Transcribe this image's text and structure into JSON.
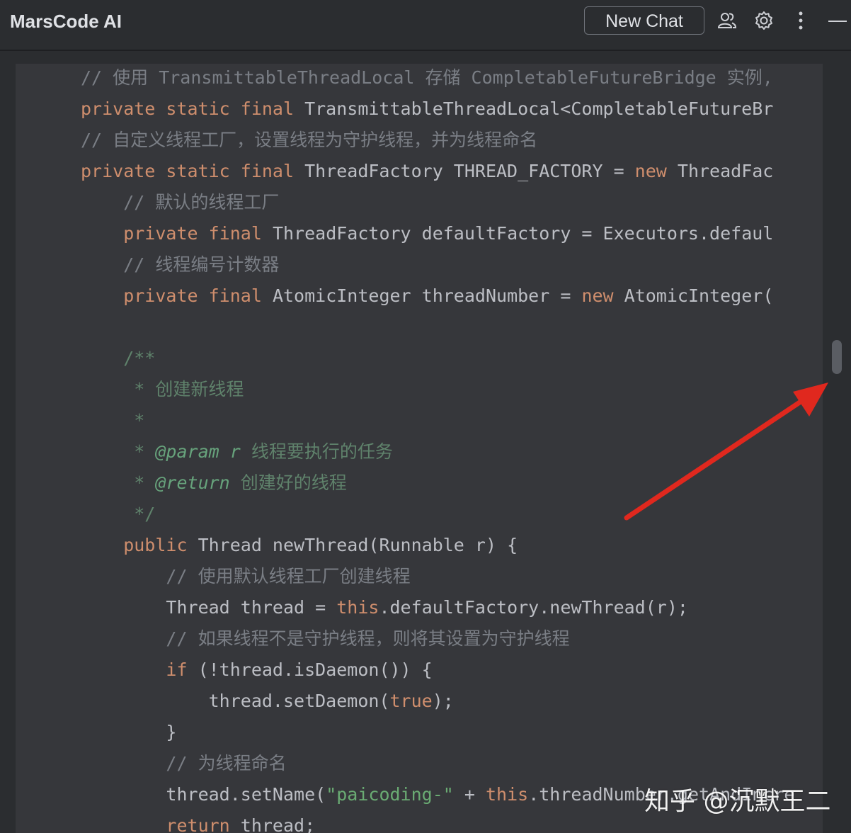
{
  "header": {
    "title": "MarsCode AI",
    "new_chat_label": "New Chat",
    "icons": [
      "users-icon",
      "gear-icon",
      "more-vertical-icon",
      "minimize-icon"
    ]
  },
  "colors": {
    "comment": "#7a7e85",
    "keyword": "#cf8e6d",
    "doc": "#5f826b",
    "string": "#6aab73",
    "text": "#bcbec4",
    "arrow": "#e0281e"
  },
  "code_lines": [
    [
      [
        "c",
        "// 使用 TransmittableThreadLocal 存储 CompletableFutureBridge 实例,"
      ]
    ],
    [
      [
        "k",
        "private static final "
      ],
      [
        "p",
        "TransmittableThreadLocal<CompletableFutureBr"
      ]
    ],
    [
      [
        "c",
        "// 自定义线程工厂，设置线程为守护线程，并为线程命名"
      ]
    ],
    [
      [
        "k",
        "private static final "
      ],
      [
        "p",
        "ThreadFactory THREAD_FACTORY = "
      ],
      [
        "k",
        "new "
      ],
      [
        "p",
        "ThreadFac"
      ]
    ],
    [
      [
        "c",
        "    // 默认的线程工厂"
      ]
    ],
    [
      [
        "k",
        "    private final "
      ],
      [
        "p",
        "ThreadFactory defaultFactory = Executors.defaul"
      ]
    ],
    [
      [
        "c",
        "    // 线程编号计数器"
      ]
    ],
    [
      [
        "k",
        "    private final "
      ],
      [
        "p",
        "AtomicInteger threadNumber = "
      ],
      [
        "k",
        "new "
      ],
      [
        "p",
        "AtomicInteger("
      ]
    ],
    [
      [
        "p",
        ""
      ]
    ],
    [
      [
        "d",
        "    /**"
      ]
    ],
    [
      [
        "d",
        "     * 创建新线程"
      ]
    ],
    [
      [
        "d",
        "     *"
      ]
    ],
    [
      [
        "d",
        "     * "
      ],
      [
        "dt",
        "@param"
      ],
      [
        "d",
        " "
      ],
      [
        "dt",
        "r"
      ],
      [
        "d",
        " 线程要执行的任务"
      ]
    ],
    [
      [
        "d",
        "     * "
      ],
      [
        "dt",
        "@return"
      ],
      [
        "d",
        " 创建好的线程"
      ]
    ],
    [
      [
        "d",
        "     */"
      ]
    ],
    [
      [
        "k",
        "    public "
      ],
      [
        "p",
        "Thread newThread(Runnable r) {"
      ]
    ],
    [
      [
        "c",
        "        // 使用默认线程工厂创建线程"
      ]
    ],
    [
      [
        "p",
        "        Thread thread = "
      ],
      [
        "k",
        "this"
      ],
      [
        "p",
        ".defaultFactory.newThread(r);"
      ]
    ],
    [
      [
        "c",
        "        // 如果线程不是守护线程，则将其设置为守护线程"
      ]
    ],
    [
      [
        "k",
        "        if "
      ],
      [
        "p",
        "(!thread.isDaemon()) {"
      ]
    ],
    [
      [
        "p",
        "            thread.setDaemon("
      ],
      [
        "k",
        "true"
      ],
      [
        "p",
        ");"
      ]
    ],
    [
      [
        "p",
        "        }"
      ]
    ],
    [
      [
        "c",
        "        // 为线程命名"
      ]
    ],
    [
      [
        "p",
        "        thread.setName("
      ],
      [
        "s",
        "\"paicoding-\""
      ],
      [
        "p",
        " + "
      ],
      [
        "k",
        "this"
      ],
      [
        "p",
        ".threadNumber.getAndIncrement());"
      ]
    ],
    [
      [
        "k",
        "        return "
      ],
      [
        "p",
        "thread;"
      ]
    ]
  ],
  "watermark": "知乎 @沉默王二"
}
